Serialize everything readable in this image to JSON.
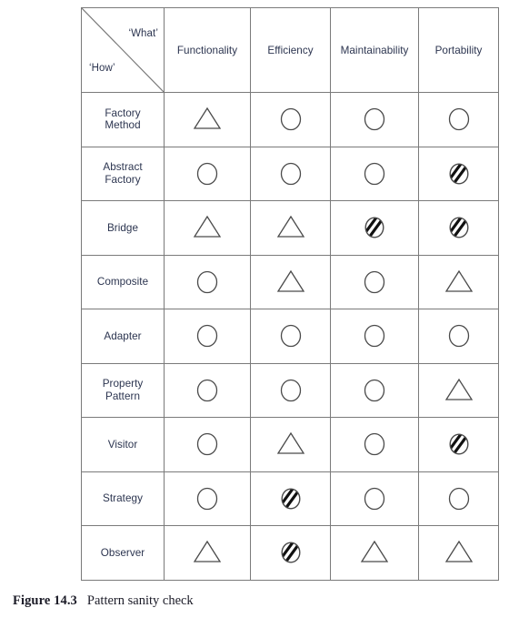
{
  "figure": {
    "caption_number": "Figure 14.3",
    "caption_text": "Pattern sanity check"
  },
  "table": {
    "corner": {
      "what_label": "‘What’",
      "how_label": "‘How’",
      "diagonal_icon": "diagonal-divider-line"
    },
    "column_headers": [
      "Functionality",
      "Efficiency",
      "Maintainability",
      "Portability"
    ],
    "row_headers": [
      {
        "line1": "Factory",
        "line2": "Method"
      },
      {
        "line1": "Abstract",
        "line2": "Factory"
      },
      {
        "line1": "Bridge",
        "line2": ""
      },
      {
        "line1": "Composite",
        "line2": ""
      },
      {
        "line1": "Adapter",
        "line2": ""
      },
      {
        "line1": "Property",
        "line2": "Pattern"
      },
      {
        "line1": "Visitor",
        "line2": ""
      },
      {
        "line1": "Strategy",
        "line2": ""
      },
      {
        "line1": "Observer",
        "line2": ""
      }
    ],
    "symbol_legend": {
      "circle": "circle-icon",
      "triangle": "triangle-icon",
      "hatched_circle": "hatched-circle-icon"
    },
    "rows": [
      {
        "pattern": "Factory Method",
        "cells": [
          "triangle",
          "circle",
          "circle",
          "circle"
        ]
      },
      {
        "pattern": "Abstract Factory",
        "cells": [
          "circle",
          "circle",
          "circle",
          "hatched-circle"
        ]
      },
      {
        "pattern": "Bridge",
        "cells": [
          "triangle",
          "triangle",
          "hatched-circle",
          "hatched-circle"
        ]
      },
      {
        "pattern": "Composite",
        "cells": [
          "circle",
          "triangle",
          "circle",
          "triangle"
        ]
      },
      {
        "pattern": "Adapter",
        "cells": [
          "circle",
          "circle",
          "circle",
          "circle"
        ]
      },
      {
        "pattern": "Property Pattern",
        "cells": [
          "circle",
          "circle",
          "circle",
          "triangle"
        ]
      },
      {
        "pattern": "Visitor",
        "cells": [
          "circle",
          "triangle",
          "circle",
          "hatched-circle"
        ]
      },
      {
        "pattern": "Strategy",
        "cells": [
          "circle",
          "hatched-circle",
          "circle",
          "circle"
        ]
      },
      {
        "pattern": "Observer",
        "cells": [
          "triangle",
          "hatched-circle",
          "triangle",
          "triangle"
        ]
      }
    ]
  },
  "colors": {
    "border": "#7a7a7a",
    "text": "#2c3550",
    "caption_text": "#1c1c28",
    "symbol_stroke": "#4a4a4a",
    "hatch_stroke": "#111111"
  }
}
